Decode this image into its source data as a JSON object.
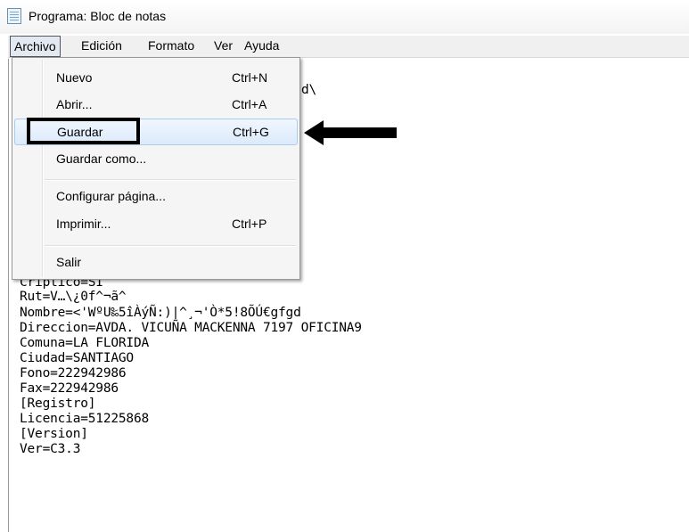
{
  "window": {
    "title": "Programa: Bloc de notas",
    "icon": "notepad-icon"
  },
  "menubar": [
    "Archivo",
    "Edición",
    "Formato",
    "Ver",
    "Ayuda"
  ],
  "dropdown": {
    "items": [
      {
        "label": "Nuevo",
        "shortcut": "Ctrl+N"
      },
      {
        "label": "Abrir...",
        "shortcut": "Ctrl+A"
      },
      {
        "label": "Guardar",
        "shortcut": "Ctrl+G"
      },
      {
        "label": "Guardar como...",
        "shortcut": ""
      },
      {
        "label": "Configurar página...",
        "shortcut": ""
      },
      {
        "label": "Imprimir...",
        "shortcut": "Ctrl+P"
      },
      {
        "label": "Salir",
        "shortcut": ""
      }
    ]
  },
  "editor": {
    "peek": "d\\",
    "lines": [
      "Criptico=SI",
      "Rut=V…\\¿0f^¬ã^",
      "Nombre=<'WºU‰5îÀýÑ:)|^¸¬'Ò*5!8ÕÚ€gfgd",
      "Direccion=AVDA. VICUÑA MACKENNA 7197 OFICINA9",
      "Comuna=LA FLORIDA",
      "Ciudad=SANTIAGO",
      "Fono=222942986",
      "Fax=222942986",
      "[Registro]",
      "Licencia=51225868",
      "[Version]",
      "Ver=C3.3"
    ]
  },
  "annotations": {
    "arrow": "left-arrow-icon"
  }
}
